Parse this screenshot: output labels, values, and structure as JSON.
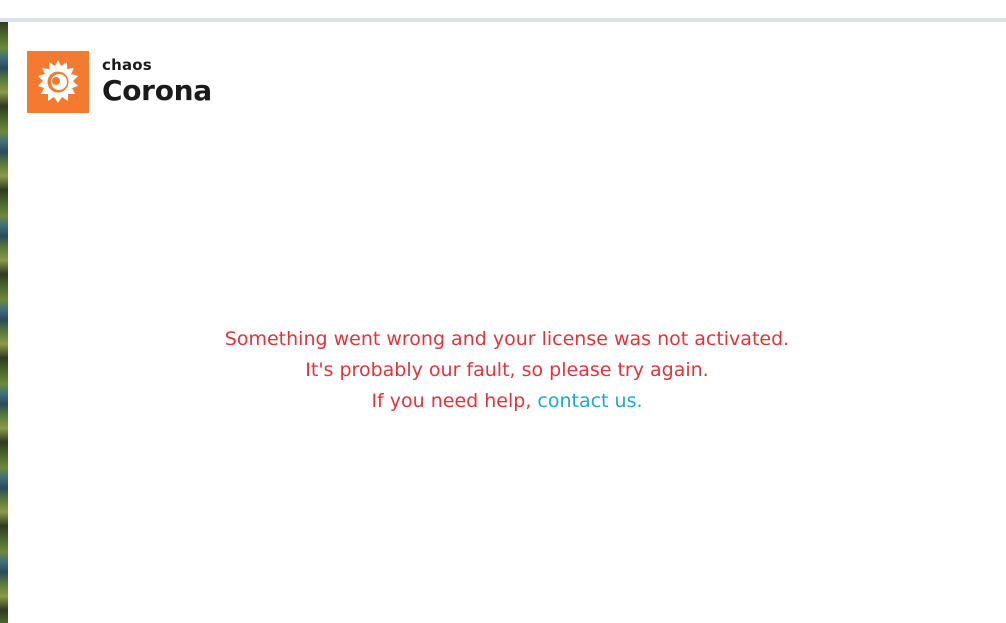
{
  "brand": {
    "small": "chaos",
    "big": "Corona",
    "logo_icon": "corona-flame-icon",
    "logo_color": "#f47a30"
  },
  "message": {
    "line1": "Something went wrong and your license was not activated.",
    "line2": "It's probably our fault, so please try again.",
    "line3_prefix": "If you need help, ",
    "link_label": "contact us.",
    "text_color": "#e0343b",
    "link_color": "#1aa9d6"
  }
}
